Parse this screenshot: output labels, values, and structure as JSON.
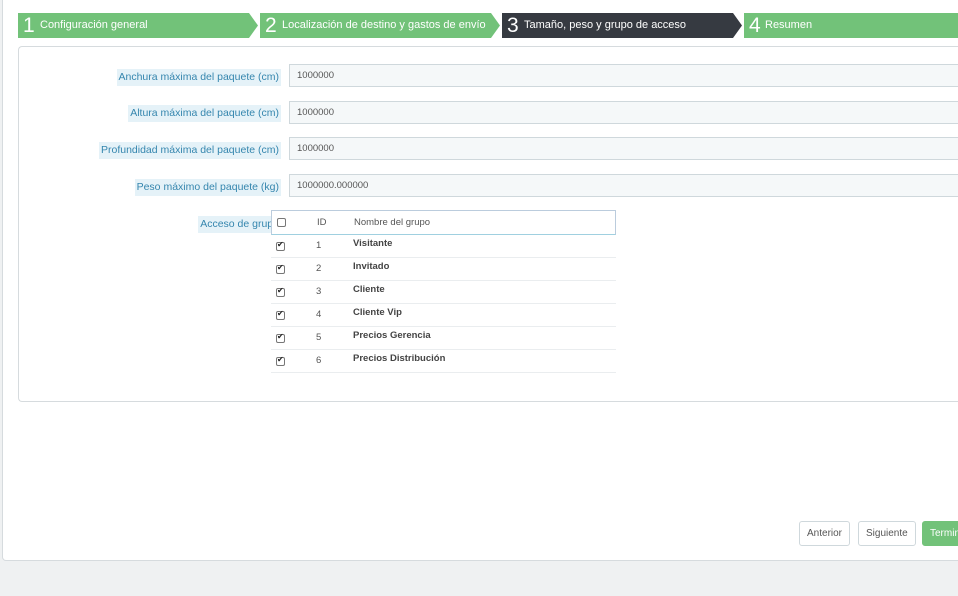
{
  "wizard": {
    "steps": [
      {
        "num": "1",
        "label": "Configuración general"
      },
      {
        "num": "2",
        "label": "Localización de destino y gastos de envío"
      },
      {
        "num": "3",
        "label": "Tamaño, peso y grupo de acceso"
      },
      {
        "num": "4",
        "label": "Resumen"
      }
    ],
    "active_step": 3
  },
  "form": {
    "max_width": {
      "label": "Anchura máxima del paquete (cm)",
      "value": "1000000"
    },
    "max_height": {
      "label": "Altura máxima del paquete (cm)",
      "value": "1000000"
    },
    "max_depth": {
      "label": "Profundidad máxima del paquete (cm)",
      "value": "1000000"
    },
    "max_weight": {
      "label": "Peso máximo del paquete (kg)",
      "value": "1000000.000000"
    },
    "group_access": {
      "label": "Acceso de grupo",
      "headers": {
        "id": "ID",
        "name": "Nombre del grupo"
      },
      "rows": [
        {
          "id": "1",
          "name": "Visitante",
          "checked": true
        },
        {
          "id": "2",
          "name": "Invitado",
          "checked": true
        },
        {
          "id": "3",
          "name": "Cliente",
          "checked": true
        },
        {
          "id": "4",
          "name": "Cliente Vip",
          "checked": true
        },
        {
          "id": "5",
          "name": "Precios Gerencia",
          "checked": true
        },
        {
          "id": "6",
          "name": "Precios Distribución",
          "checked": true
        }
      ]
    }
  },
  "buttons": {
    "previous": "Anterior",
    "next": "Siguiente",
    "finish": "Terminar"
  },
  "colors": {
    "step_done": "#72c279",
    "step_active": "#363a41",
    "label_text": "#3586ae",
    "label_bg": "#e5f2f8",
    "primary_button": "#72c279"
  }
}
